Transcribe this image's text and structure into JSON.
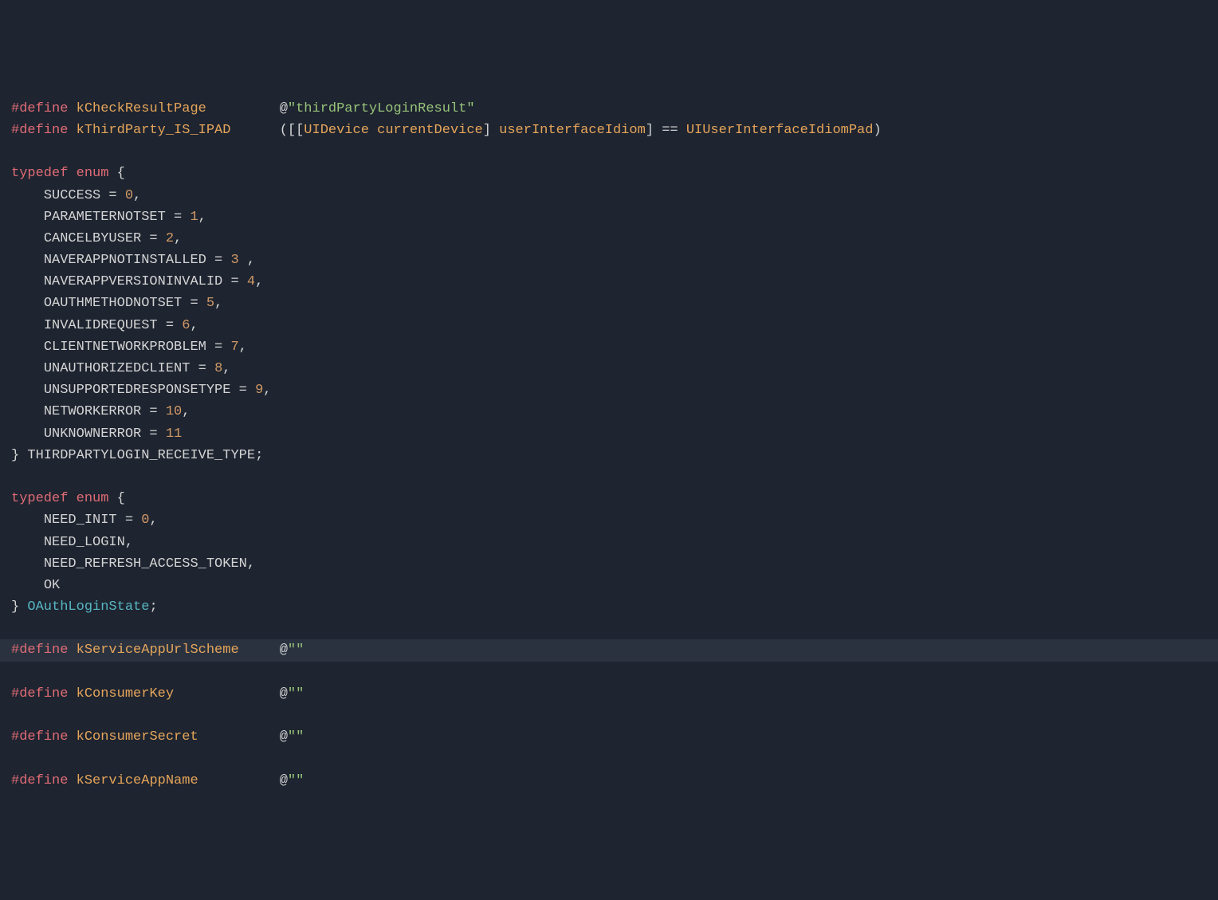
{
  "lines": {
    "l1": {
      "directive": "#define",
      "name": "kCheckResultPage",
      "value_at": "@",
      "value_str": "\"thirdPartyLoginResult\""
    },
    "l2": {
      "directive": "#define",
      "name": "kThirdParty_IS_IPAD",
      "expr_open": "([[",
      "cls": "UIDevice",
      "method1": "currentDevice",
      "bracket1": "]",
      "method2": "userInterfaceIdiom",
      "bracket2": "]",
      "eq": "==",
      "idiom": "UIUserInterfaceIdiomPad",
      "close": ")"
    },
    "l4": {
      "kw1": "typedef",
      "kw2": "enum",
      "brace": "{"
    },
    "l5": {
      "name": "SUCCESS",
      "eq": " = ",
      "num": "0",
      "comma": ","
    },
    "l6": {
      "name": "PARAMETERNOTSET",
      "eq": " = ",
      "num": "1",
      "comma": ","
    },
    "l7": {
      "name": "CANCELBYUSER",
      "eq": " = ",
      "num": "2",
      "comma": ","
    },
    "l8": {
      "name": "NAVERAPPNOTINSTALLED",
      "eq": " = ",
      "num": "3",
      "tail": " ,"
    },
    "l9": {
      "name": "NAVERAPPVERSIONINVALID",
      "eq": " = ",
      "num": "4",
      "comma": ","
    },
    "l10": {
      "name": "OAUTHMETHODNOTSET",
      "eq": " = ",
      "num": "5",
      "comma": ","
    },
    "l11": {
      "name": "INVALIDREQUEST",
      "eq": " = ",
      "num": "6",
      "comma": ","
    },
    "l12": {
      "name": "CLIENTNETWORKPROBLEM",
      "eq": " = ",
      "num": "7",
      "comma": ","
    },
    "l13": {
      "name": "UNAUTHORIZEDCLIENT",
      "eq": " = ",
      "num": "8",
      "comma": ","
    },
    "l14": {
      "name": "UNSUPPORTEDRESPONSETYPE",
      "eq": " = ",
      "num": "9",
      "comma": ","
    },
    "l15": {
      "name": "NETWORKERROR",
      "eq": " = ",
      "num": "10",
      "comma": ","
    },
    "l16": {
      "name": "UNKNOWNERROR",
      "eq": " = ",
      "num": "11"
    },
    "l17": {
      "brace": "} ",
      "type": "THIRDPARTYLOGIN_RECEIVE_TYPE",
      "semi": ";"
    },
    "l19": {
      "kw1": "typedef",
      "kw2": "enum",
      "brace": "{"
    },
    "l20": {
      "name": "NEED_INIT",
      "eq": " = ",
      "num": "0",
      "comma": ","
    },
    "l21": {
      "name": "NEED_LOGIN",
      "comma": ","
    },
    "l22": {
      "name": "NEED_REFRESH_ACCESS_TOKEN",
      "comma": ","
    },
    "l23": {
      "name": "OK"
    },
    "l24": {
      "brace": "} ",
      "type": "OAuthLoginState",
      "semi": ";"
    },
    "l26": {
      "directive": "#define",
      "name": "kServiceAppUrlScheme",
      "at": "@",
      "str": "\"\""
    },
    "l28": {
      "directive": "#define",
      "name": "kConsumerKey",
      "at": "@",
      "str": "\"\""
    },
    "l30": {
      "directive": "#define",
      "name": "kConsumerSecret",
      "at": "@",
      "str": "\"\""
    },
    "l32": {
      "directive": "#define",
      "name": "kServiceAppName",
      "at": "@",
      "str": "\"\""
    }
  }
}
